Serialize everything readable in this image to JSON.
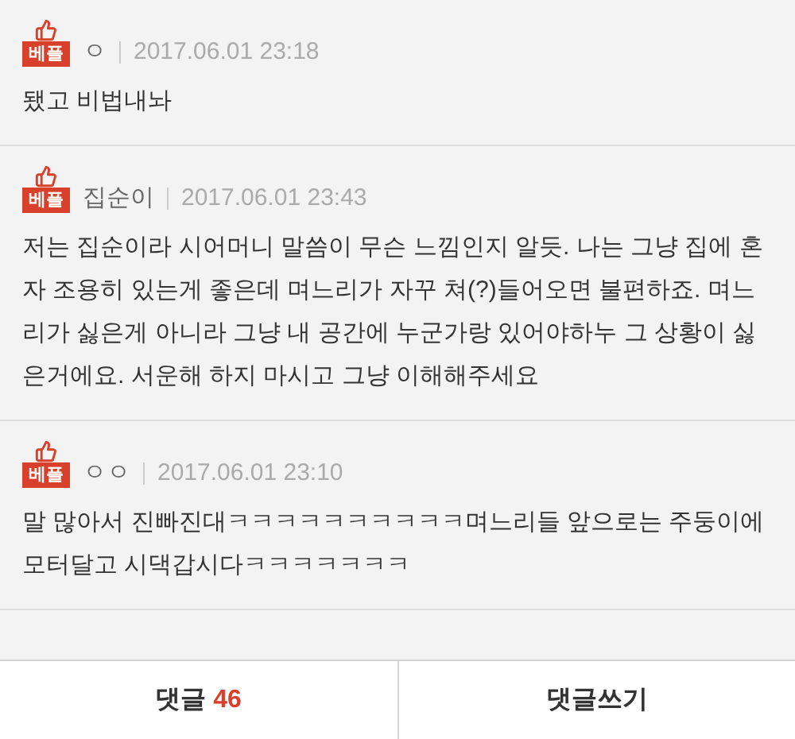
{
  "comments": [
    {
      "badge": "베플",
      "author": "ㅇ",
      "date": "2017.06.01 23:18",
      "body": "됐고 비법내놔"
    },
    {
      "badge": "베플",
      "author": "집순이",
      "date": "2017.06.01 23:43",
      "body": "저는 집순이라 시어머니 말씀이 무슨 느낌인지 알듯. 나는 그냥 집에 혼자 조용히 있는게 좋은데 며느리가 자꾸 쳐(?)들어오면 불편하죠. 며느리가 싫은게 아니라 그냥 내 공간에 누군가랑 있어야하누 그 상황이 싫은거에요. 서운해 하지 마시고 그냥 이해해주세요"
    },
    {
      "badge": "베플",
      "author": "ㅇㅇ",
      "date": "2017.06.01 23:10",
      "body": "말 많아서 진빠진대ㅋㅋㅋㅋㅋㅋㅋㅋㅋㅋ며느리들 앞으로는 주둥이에 모터달고 시댁갑시다ㅋㅋㅋㅋㅋㅋㅋ"
    }
  ],
  "footer": {
    "comments_label": "댓글",
    "comments_count": "46",
    "write_label": "댓글쓰기"
  }
}
